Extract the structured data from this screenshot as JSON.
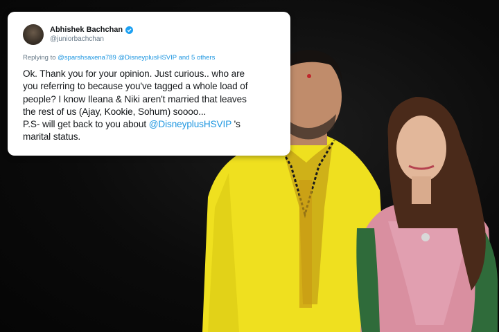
{
  "tweet": {
    "display_name": "Abhishek Bachchan",
    "handle": "@juniorbachchan",
    "replying_to_prefix": "Replying to ",
    "replying_to_mention_1": "@sparshsaxena789",
    "replying_to_mention_2": "@DisneyplusHSVIP",
    "replying_to_others": "and 5 others",
    "text_lines": [
      "Ok. Thank you for your opinion. Just curious.. who are",
      "you referring to because you've tagged a whole load of",
      "people? I know Ileana & Niki aren't married that leaves",
      "the rest of us (Ajay, Kookie, Sohum) soooo...",
      "P.S- will get back to you about "
    ],
    "text_mention": "@DisneyplusHSVIP",
    "text_after_mention": " 's",
    "text_last_line": "marital status.",
    "icons": {
      "verified": "verified-badge-icon",
      "avatar": "avatar"
    }
  },
  "colors": {
    "background": "#0b0b0b",
    "mention_blue": "#1b95e0",
    "verified_blue": "#1da1f2",
    "kurta_yellow": "#f2e21c"
  }
}
